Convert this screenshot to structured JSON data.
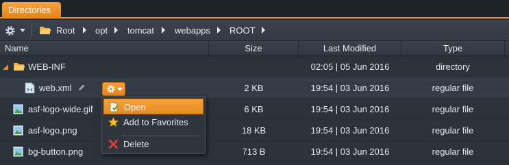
{
  "tab": {
    "label": "Directories"
  },
  "toolbar": {
    "breadcrumb": [
      "Root",
      "opt",
      "tomcat",
      "webapps",
      "ROOT"
    ]
  },
  "columns": {
    "name": "Name",
    "size": "Size",
    "modified": "Last Modified",
    "type": "Type"
  },
  "rows": [
    {
      "name": "WEB-INF",
      "size": "",
      "modified": "02:05 | 05 Jun 2016",
      "type": "directory",
      "icon": "folder-open-icon"
    },
    {
      "name": "web.xml",
      "size": "2 KB",
      "modified": "19:54 | 03 Jun 2016",
      "type": "regular file",
      "icon": "xml-file-icon"
    },
    {
      "name": "asf-logo-wide.gif",
      "size": "6 KB",
      "modified": "19:54 | 03 Jun 2016",
      "type": "regular file",
      "icon": "image-file-icon"
    },
    {
      "name": "asf-logo.png",
      "size": "18 KB",
      "modified": "19:54 | 03 Jun 2016",
      "type": "regular file",
      "icon": "image-file-icon"
    },
    {
      "name": "bg-button.png",
      "size": "713 B",
      "modified": "19:54 | 03 Jun 2016",
      "type": "regular file",
      "icon": "image-file-icon"
    }
  ],
  "context_menu": {
    "items": [
      {
        "label": "Open",
        "icon": "open-file-icon",
        "highlighted": true
      },
      {
        "label": "Add to Favorites",
        "icon": "star-icon"
      },
      {
        "label": "Delete",
        "icon": "delete-x-icon"
      }
    ]
  },
  "colors": {
    "accent": "#f0932b",
    "background": "#2b323a",
    "delete": "#e03a3a"
  }
}
